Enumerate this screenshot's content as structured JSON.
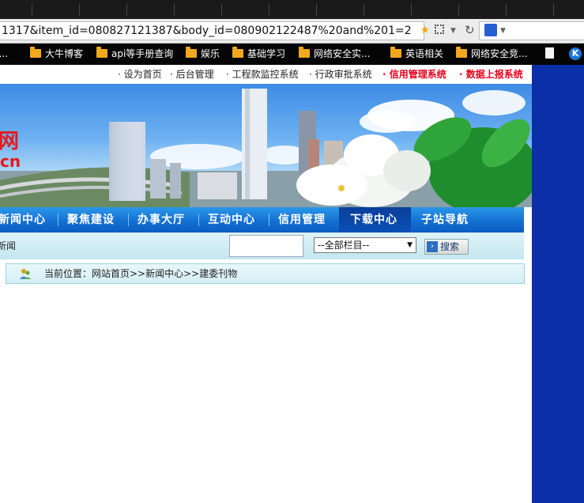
{
  "browser": {
    "url": "1317&item_id=080827121387&body_id=080902122487%20and%201=2",
    "bookmarks": [
      "大牛博客",
      "api等手册查询",
      "娱乐",
      "基础学习",
      "网络安全实...",
      "英语相关",
      "网络安全竞..."
    ],
    "bookmark_partial": "t..."
  },
  "site": {
    "top_links": [
      "· 设为首页",
      "· 后台管理",
      "· 工程款监控系统",
      "· 行政审批系统",
      "· 信用管理系统",
      "· 数据上报系统"
    ],
    "banner_logo_fragment_1": "网",
    "banner_logo_fragment_2": "cn",
    "nav": [
      "新闻中心",
      "聚焦建设",
      "办事大厅",
      "互动中心",
      "信用管理",
      "下载中心",
      "子站导航"
    ],
    "news_label": "新闻",
    "search": {
      "input_value": "",
      "select_value": "--全部栏目--",
      "button_label": "搜索"
    },
    "breadcrumb": "当前位置：网站首页>>新闻中心>>建委刊物"
  },
  "colors": {
    "nav_blue": "#1470d2",
    "nav_active": "#0a3f9a",
    "highlight_red": "#e8001d",
    "right_panel": "#0a2fa8"
  }
}
